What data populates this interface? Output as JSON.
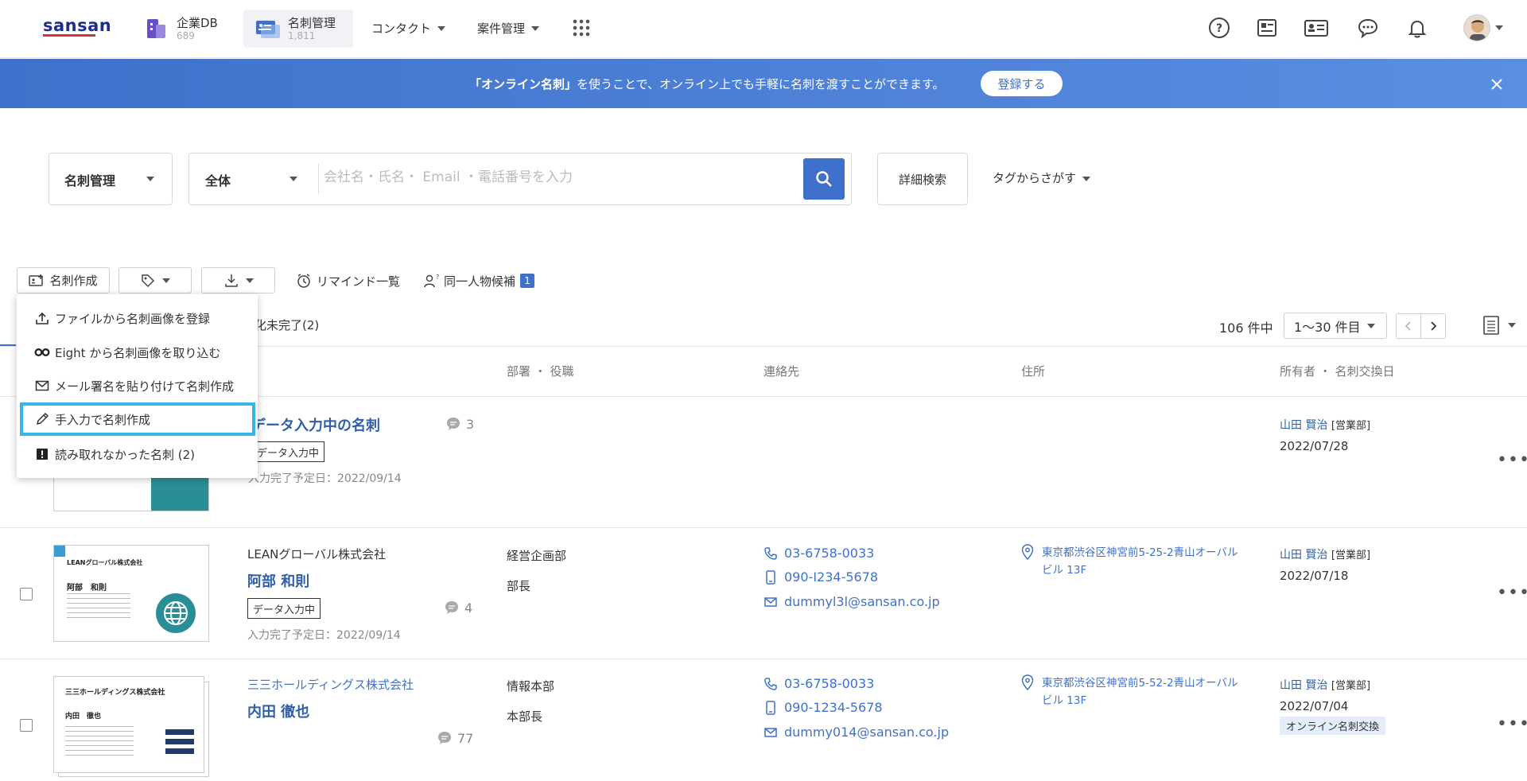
{
  "nav": {
    "logo": "sansan",
    "items": [
      {
        "label": "企業DB",
        "count": "689"
      },
      {
        "label": "名刺管理",
        "count": "1,811"
      },
      {
        "label": "コンタクト"
      },
      {
        "label": "案件管理"
      }
    ]
  },
  "banner": {
    "bold": "「オンライン名刺」",
    "text": "を使うことで、オンライン上でも手軽に名刺を渡すことができます。",
    "button": "登録する"
  },
  "search": {
    "scope": "名刺管理",
    "filter": "全体",
    "placeholder": "会社名・氏名・ Email ・電話番号を入力",
    "detail_button": "詳細検索",
    "tag_search": "タグからさがす"
  },
  "toolbar": {
    "create": "名刺作成",
    "remind": "リマインド一覧",
    "duplicate": "同一人物候補",
    "duplicate_count": "1"
  },
  "dropdown": [
    "ファイルから名刺画像を登録",
    "Eight から名刺画像を取り込む",
    "メール署名を貼り付けて名刺作成",
    "手入力で名刺作成",
    "読み取れなかった名刺 (2)"
  ],
  "tabs": {
    "incomplete": "化未完了(2)"
  },
  "pager": {
    "total": "106 件中",
    "range": "1〜30 件目"
  },
  "columns": [
    "部署 ・ 役職",
    "連絡先",
    "住所",
    "所有者 ・ 名刺交換日"
  ],
  "rows": [
    {
      "person": "データ入力中の名刺",
      "status": "データ入力中",
      "due": "入力完了予定日：2022/09/14",
      "comments": "3",
      "owner": "山田 賢治",
      "owner_dept": "[営業部]",
      "date": "2022/07/28"
    },
    {
      "company": "LEANグローバル株式会社",
      "person": "阿部 和則",
      "status": "データ入力中",
      "due": "入力完了予定日：2022/09/14",
      "comments": "4",
      "dept": "経営企画部",
      "title": "部長",
      "tel": "03-6758-0033",
      "mobile": "090-I234-5678",
      "email": "dummyl3l@sansan.co.jp",
      "address1": "東京都渋谷区神宮前5-25-2青山オーバル",
      "address2": "ビル 13F",
      "owner": "山田 賢治",
      "owner_dept": "[営業部]",
      "date": "2022/07/18",
      "card": {
        "company": "LEANグローバル株式会社",
        "name": "阿部　和則"
      }
    },
    {
      "company": "三三ホールディングス株式会社",
      "person": "内田 徹也",
      "comments": "77",
      "dept": "情報本部",
      "title": "本部長",
      "tel": "03-6758-0033",
      "mobile": "090-1234-5678",
      "email": "dummy014@sansan.co.jp",
      "address1": "東京都渋谷区神宮前5-52-2青山オーバル",
      "address2": "ビル 13F",
      "owner": "山田 賢治",
      "owner_dept": "[営業部]",
      "date": "2022/07/04",
      "tag": "オンライン名刺交換",
      "card": {
        "company": "三三ホールディングス株式会社",
        "name": "内田　徹也"
      }
    }
  ]
}
